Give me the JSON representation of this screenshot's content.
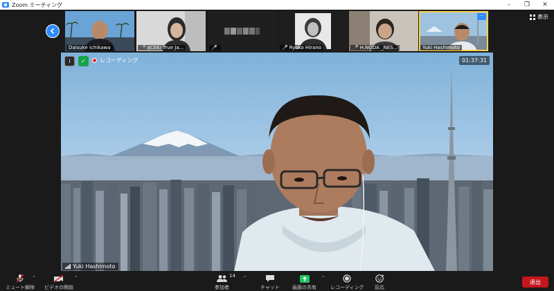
{
  "window": {
    "title": "Zoom ミーティング",
    "controls": [
      "minimize",
      "restore",
      "close"
    ]
  },
  "gallery": {
    "view_label": "表示",
    "participants": [
      {
        "name": "Daisuke Ichikawa",
        "muted": false,
        "active": false
      },
      {
        "name": "IJCEE/ True Ja...",
        "muted": true,
        "active": false
      },
      {
        "name": "",
        "muted": true,
        "active": false
      },
      {
        "name": "Ryoko Hirano",
        "muted": true,
        "active": false
      },
      {
        "name": "H.NODA _NES...",
        "muted": true,
        "active": false
      },
      {
        "name": "Yuki Hashimoto",
        "muted": false,
        "active": true
      }
    ]
  },
  "main_video": {
    "speaker_name": "Yuki Hashimoto",
    "recording_label": "レコーディング",
    "elapsed_time": "01:37:31"
  },
  "toolbar": {
    "unmute_label": "ミュート解除",
    "start_video_label": "ビデオの開始",
    "participants_label": "参加者",
    "participants_count": "14",
    "chat_label": "チャット",
    "share_screen_label": "画面の共有",
    "record_label": "レコーディング",
    "reactions_label": "反応",
    "leave_label": "退出"
  },
  "colors": {
    "accent": "#2d8cff",
    "share": "#22c55e",
    "leave": "#c4161c",
    "muted": "#e02828",
    "active_speaker": "#fcd34d"
  }
}
